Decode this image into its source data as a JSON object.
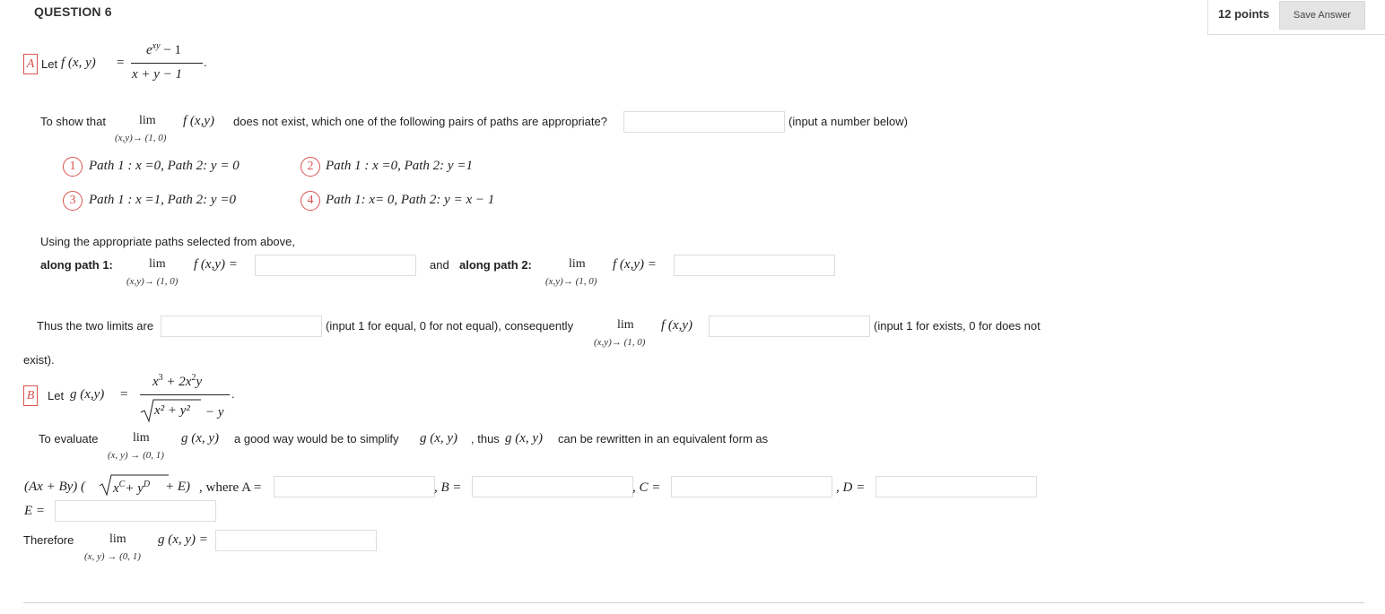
{
  "header": {
    "title": "QUESTION 6",
    "points": "12 points",
    "save_label": "Save Answer"
  },
  "partA": {
    "label": "A",
    "let_text": "Let",
    "f_name": "f (x, y)",
    "equals": "=",
    "numerator": "e",
    "numerator_exp": "xy",
    "numerator_rest": "− 1",
    "denominator": "x + y − 1",
    "period": ".",
    "q_prefix": "To show that",
    "lim": "lim",
    "lim_sub": "(x,y)→ (1, 0)",
    "fxy": "f (x,y)",
    "q_suffix": "does  not exist, which one of the following pairs of paths are appropriate?",
    "q_hint": "(input a number below)",
    "options": [
      {
        "num": "1",
        "text": "Path 1 : x =0,  Path 2: y  = 0"
      },
      {
        "num": "2",
        "text": "Path 1 : x =0,  Path 2: y  =1"
      },
      {
        "num": "3",
        "text": "Path 1 : x =1,  Path 2: y  =0"
      },
      {
        "num": "4",
        "text": "Path 1: x= 0,  Path 2: y = x − 1"
      }
    ],
    "using_text": "Using the appropriate paths selected from above,",
    "along1": "along path 1:",
    "along2_and": "and",
    "along2": "along path 2:",
    "f_eq": "f (x,y) =",
    "thus_text": "Thus the two limits are",
    "thus_hint": "(input 1 for equal, 0 for not equal),  consequently",
    "exists_hint": "(input 1 for exists, 0 for does not",
    "exists_tail": "exist)."
  },
  "partB": {
    "label": "B",
    "let_text": "Let",
    "g_name": "g (x,y)",
    "equals": "=",
    "num_x": "x",
    "num_x_exp": "3",
    "num_plus": "+ 2x",
    "num_x2_exp": "2",
    "num_y": "y",
    "den_inner": "x² + y²",
    "den_rest": "−  y",
    "period": ".",
    "eval_prefix": "To evaluate",
    "lim": "lim",
    "lim_sub": "(x, y) → (0, 1)",
    "gxy": "g (x, y)",
    "eval_mid": "a good way would be  to simplify",
    "eval_g2": "g (x, y)",
    "eval_thus": ", thus",
    "eval_g3": "g (x, y)",
    "eval_suffix": "can be rewritten in an equivalent form as",
    "form_text": "(Ax + By) (",
    "form_x": "x",
    "form_C": "C",
    "form_plus": "+ y",
    "form_D": "D",
    "form_end": "+ E)",
    "where_text": ", where A =",
    "B_eq": ", B =",
    "C_eq": ", C =",
    "D_eq": ", D =",
    "E_eq": "E =",
    "therefore": "Therefore",
    "g_eq": "g (x, y) ="
  }
}
